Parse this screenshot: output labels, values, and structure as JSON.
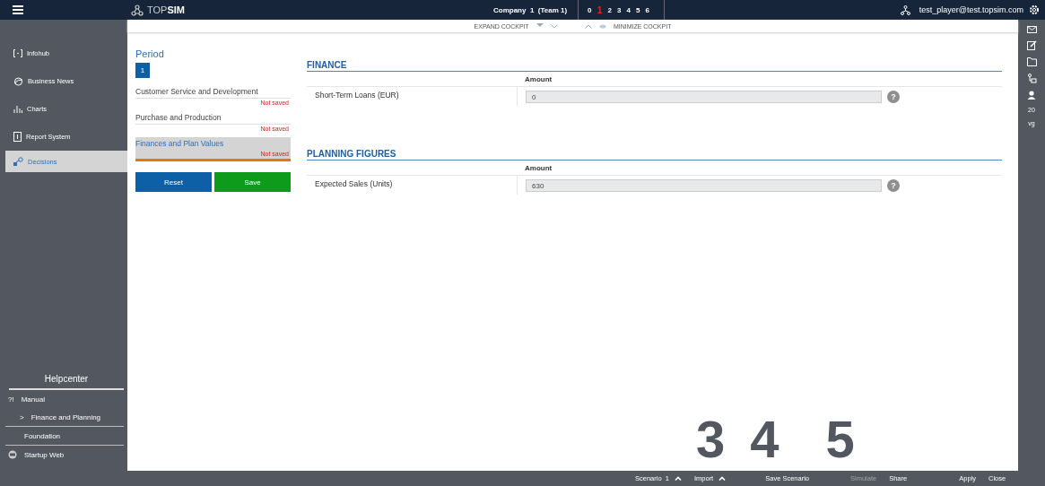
{
  "topbar": {
    "brand_light": "TOP",
    "brand_bold": "SIM",
    "company": "Company  1  (Team 1)",
    "periods": [
      {
        "label": "0",
        "selected": false
      },
      {
        "label": "1",
        "selected": true
      },
      {
        "label": "2",
        "selected": false
      },
      {
        "label": "3",
        "selected": false
      },
      {
        "label": "4",
        "selected": false
      },
      {
        "label": "5",
        "selected": false
      },
      {
        "label": "6",
        "selected": false
      }
    ],
    "user": "test_player@test.topsim.com"
  },
  "cockpit": {
    "expand": "EXPAND COCKPIT",
    "minimize": "MINIMIZE COCKPIT"
  },
  "sidebar": {
    "items": [
      {
        "label": "Infohub",
        "selected": false
      },
      {
        "label": "Business News",
        "selected": false
      },
      {
        "label": "Charts",
        "selected": false
      },
      {
        "label": "Report System",
        "selected": false
      },
      {
        "label": "Decisions",
        "selected": true
      }
    ],
    "helpcenter": {
      "title": "Helpcenter",
      "items": [
        {
          "label": "Manual",
          "kind": "main",
          "icon": "?!"
        },
        {
          "label": "Finance and Planning",
          "kind": "sub",
          "icon": ">"
        },
        {
          "label": "Foundation",
          "kind": "plain"
        },
        {
          "label": "Startup Web",
          "kind": "web"
        }
      ]
    }
  },
  "decisions": {
    "period_title": "Period",
    "period": "1",
    "sections": [
      {
        "label": "Customer Service and Development",
        "status": "Not saved",
        "selected": false
      },
      {
        "label": "Purchase and Production",
        "status": "Not saved",
        "selected": false
      },
      {
        "label": "Finances and Plan Values",
        "status": "Not saved",
        "selected": true
      }
    ],
    "buttons": [
      {
        "label": "Reset",
        "kind": "primary"
      },
      {
        "label": "Save",
        "kind": "success"
      }
    ]
  },
  "groups": [
    {
      "title": "FINANCE",
      "column": "Amount",
      "rows": [
        {
          "label": "Short-Term Loans (EUR)",
          "value": "0",
          "help": "?"
        }
      ]
    },
    {
      "title": "PLANNING FIGURES",
      "column": "Amount",
      "rows": [
        {
          "label": "Expected Sales (Units)",
          "value": "630",
          "help": "?"
        }
      ]
    }
  ],
  "callouts": [
    "3",
    "4",
    "5"
  ],
  "rail": {
    "texts": [
      "20",
      "vg"
    ]
  },
  "bottombar": {
    "scenario": "Scenario  1",
    "import": "Import",
    "actions": [
      {
        "label": "Save Scenario",
        "disabled": false
      },
      {
        "label": "Simulate",
        "disabled": true
      },
      {
        "label": "Share",
        "disabled": false
      },
      {
        "label": "Apply",
        "disabled": false
      },
      {
        "label": "Close",
        "disabled": false
      }
    ]
  }
}
